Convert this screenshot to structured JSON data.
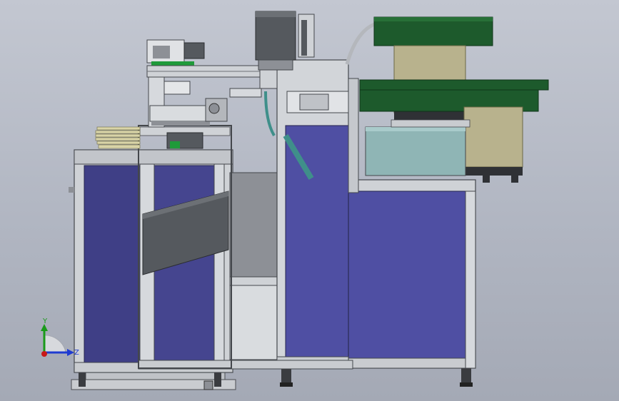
{
  "colors": {
    "background_top": "#c3c7d1",
    "background_bottom": "#a4a9b5",
    "frame_steel": "#c9ccd0",
    "panel_blue": "#4f4fa3",
    "panel_blue_dark": "#3f3f86",
    "feeder_bowl_green": "#1d5a2c",
    "feeder_body_beige": "#b8b28d",
    "hopper_glass": "#8fb5b5",
    "motor_grey": "#55595e",
    "tube_teal": "#3f8f8a",
    "axis_y": "#1a9a1a",
    "axis_z": "#1f3bd1",
    "axis_origin": "#c81818"
  },
  "icons": {
    "triad": "coordinate-triad-icon",
    "motor": "servo-motor-icon"
  },
  "triad": {
    "y_label": "Y",
    "z_label": "Z"
  }
}
